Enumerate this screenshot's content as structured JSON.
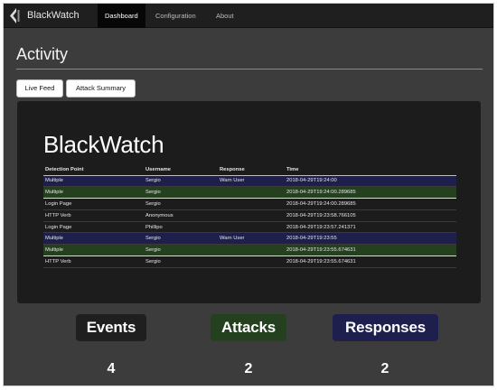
{
  "navbar": {
    "brand": "BlackWatch",
    "tabs": [
      {
        "label": "Dashboard",
        "active": true
      },
      {
        "label": "Configuration",
        "active": false
      },
      {
        "label": "About",
        "active": false
      }
    ]
  },
  "page": {
    "title": "Activity",
    "buttons": [
      {
        "label": "Live Feed"
      },
      {
        "label": "Attack Summary"
      }
    ]
  },
  "panel": {
    "title": "BlackWatch",
    "table": {
      "headers": [
        "Detection Point",
        "Username",
        "Response",
        "Time"
      ],
      "rows": [
        {
          "cells": [
            "Multiple",
            "Sergio",
            "Warn User",
            "2018-04-29T19:24:00"
          ],
          "style": "warn"
        },
        {
          "cells": [
            "Multiple",
            "Sergio",
            "",
            "2018-04-29T19:24:00.289685"
          ],
          "style": "green"
        },
        {
          "cells": [
            "Login Page",
            "Sergio",
            "",
            "2018-04-29T19:24:00.289685"
          ],
          "style": ""
        },
        {
          "cells": [
            "HTTP Verb",
            "Anonymous",
            "",
            "2018-04-29T19:23:58.766105"
          ],
          "style": ""
        },
        {
          "cells": [
            "Login Page",
            "Phillipo",
            "",
            "2018-04-29T19:23:57.241371"
          ],
          "style": ""
        },
        {
          "cells": [
            "Multiple",
            "Sergio",
            "Warn User",
            "2018-04-29T19:23:55"
          ],
          "style": "warn"
        },
        {
          "cells": [
            "Multiple",
            "Sergio",
            "",
            "2018-04-29T19:23:55.674631"
          ],
          "style": "green"
        },
        {
          "cells": [
            "HTTP Verb",
            "Sergio",
            "",
            "2018-04-29T19:23:55.674631"
          ],
          "style": ""
        }
      ]
    }
  },
  "counters": [
    {
      "label": "Events",
      "value": "4",
      "color": "#1f1f1f"
    },
    {
      "label": "Attacks",
      "value": "2",
      "color": "#24401f"
    },
    {
      "label": "Responses",
      "value": "2",
      "color": "#1f1f4d"
    }
  ]
}
